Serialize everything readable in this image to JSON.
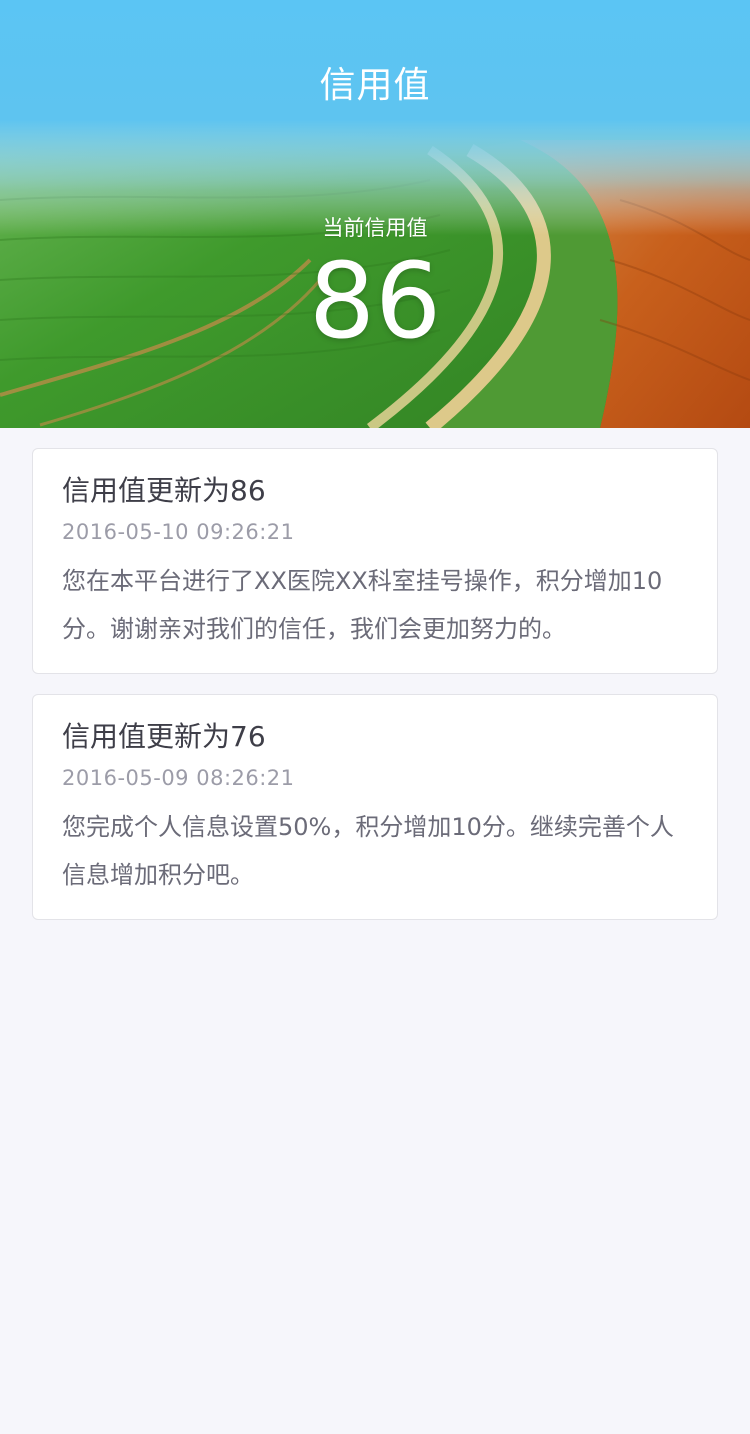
{
  "header": {
    "title": "信用值"
  },
  "summary": {
    "label": "当前信用值",
    "value": "86"
  },
  "records": [
    {
      "title": "信用值更新为86",
      "time": "2016-05-10 09:26:21",
      "desc": "您在本平台进行了XX医院XX科室挂号操作，积分增加10分。谢谢亲对我们的信任，我们会更加努力的。"
    },
    {
      "title": "信用值更新为76",
      "time": "2016-05-09 08:26:21",
      "desc": "您完成个人信息设置50%，积分增加10分。继续完善个人信息增加积分吧。"
    }
  ],
  "colors": {
    "sky": "#5bc5f4",
    "field_green": "#3c9a2a",
    "field_orange": "#c2561a",
    "background": "#f6f6fb"
  }
}
